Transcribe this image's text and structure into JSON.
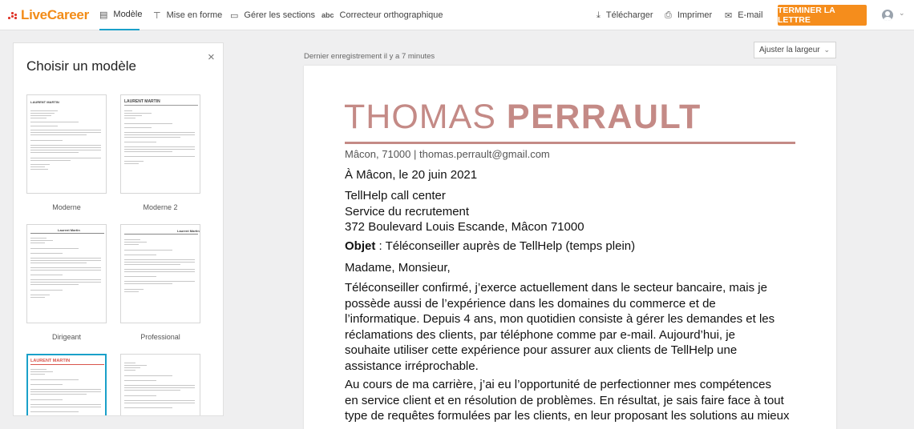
{
  "header": {
    "logo": "LiveCareer",
    "nav": [
      {
        "label": "Modèle",
        "icon": "document-icon",
        "glyph": "▤"
      },
      {
        "label": "Mise en forme",
        "icon": "format-icon",
        "glyph": "⊤"
      },
      {
        "label": "Gérer les sections",
        "icon": "sections-icon",
        "glyph": "▭"
      },
      {
        "label": "Correcteur orthographique",
        "icon": "spellcheck-icon",
        "glyph": "abc"
      }
    ],
    "actions": [
      {
        "label": "Télécharger",
        "icon": "download-icon",
        "glyph": "⤓"
      },
      {
        "label": "Imprimer",
        "icon": "print-icon",
        "glyph": "⎙"
      },
      {
        "label": "E-mail",
        "icon": "email-icon",
        "glyph": "✉"
      }
    ],
    "finish_button": "TERMINER LA LETTRE"
  },
  "panel": {
    "title": "Choisir un modèle",
    "close": "×",
    "templates": [
      {
        "label": "Moderne",
        "name": "LAURENT MARTIN"
      },
      {
        "label": "Moderne 2",
        "name": "LAURENT MARTIN"
      },
      {
        "label": "Dirigeant",
        "name": "Laurent Martin"
      },
      {
        "label": "Professional",
        "name": "Laurent Martin"
      },
      {
        "label": "",
        "name": "LAURENT MARTIN"
      },
      {
        "label": "",
        "name": ""
      }
    ]
  },
  "document": {
    "saved_status": "Dernier enregistrement il y a 7 minutes",
    "zoom_label": "Ajuster la largeur",
    "first_name": "THOMAS",
    "last_name": "PERRAULT",
    "contact": "Mâcon, 71000 | thomas.perrault@gmail.com",
    "date_line": "À Mâcon, le 20 juin 2021",
    "recipient": [
      "TellHelp call center",
      "Service du recrutement",
      "372 Boulevard Louis Escande, Mâcon 71000"
    ],
    "subject_label": "Objet",
    "subject_text": " : Téléconseiller auprès de TellHelp (temps plein)",
    "salutation": "Madame, Monsieur,",
    "paragraph1": [
      "Téléconseiller confirmé, j’exerce actuellement dans le secteur bancaire, mais je",
      "possède aussi de l’expérience dans les domaines du commerce et de",
      "l’informatique. Depuis 4 ans, mon quotidien consiste à gérer les demandes et les",
      "réclamations des clients, par téléphone comme par e-mail. Aujourd’hui, je",
      "souhaite utiliser cette expérience pour assurer aux clients de TellHelp une",
      "assistance irréprochable."
    ],
    "paragraph2": [
      "Au cours de ma carrière, j’ai eu l’opportunité de perfectionner mes compétences",
      "en service client et en résolution de problèmes. En résultat, je sais faire face à tout",
      "type de requêtes formulées par les clients, en leur proposant les solutions au mieux"
    ]
  },
  "colors": {
    "accent": "#f58d1c",
    "active_tab": "#1aa0c9",
    "name_color": "#c48a86",
    "selected_template": "#1aa0c9"
  }
}
